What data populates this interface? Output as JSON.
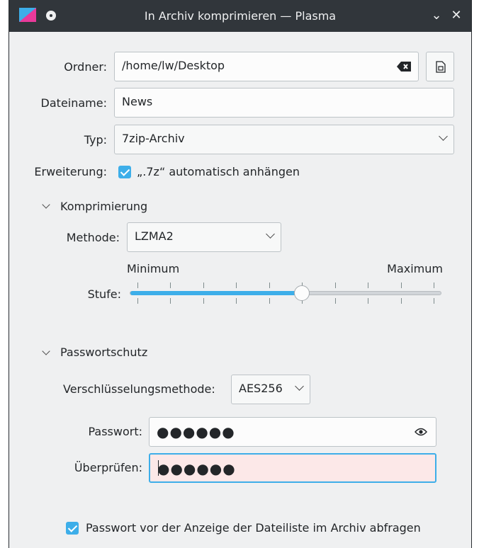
{
  "window": {
    "title": "In Archiv komprimieren — Plasma"
  },
  "form": {
    "folder_label": "Ordner:",
    "folder_value": "/home/lw/Desktop",
    "filename_label": "Dateiname:",
    "filename_value": "News",
    "type_label": "Typ:",
    "type_value": "7zip-Archiv",
    "extension_label": "Erweiterung:",
    "extension_checkbox_label": "„.7z“ automatisch anhängen",
    "extension_checked": true
  },
  "compression": {
    "section_title": "Komprimierung",
    "method_label": "Methode:",
    "method_value": "LZMA2",
    "level_label": "Stufe:",
    "min_label": "Minimum",
    "max_label": "Maximum",
    "level_value": 5,
    "level_max": 9
  },
  "password": {
    "section_title": "Passwortschutz",
    "encryption_label": "Verschlüsselungsmethode:",
    "encryption_value": "AES256",
    "password_label": "Passwort:",
    "password_value": "●●●●●●",
    "verify_label": "Überprüfen:",
    "verify_value": "●●●●●●",
    "header_encryption_label": "Passwort vor der Anzeige der Dateiliste im Archiv abfragen",
    "header_encryption_checked": true
  },
  "colors": {
    "accent": "#3daee9",
    "titlebar": "#31363b",
    "error_field": "#fce8e8"
  }
}
